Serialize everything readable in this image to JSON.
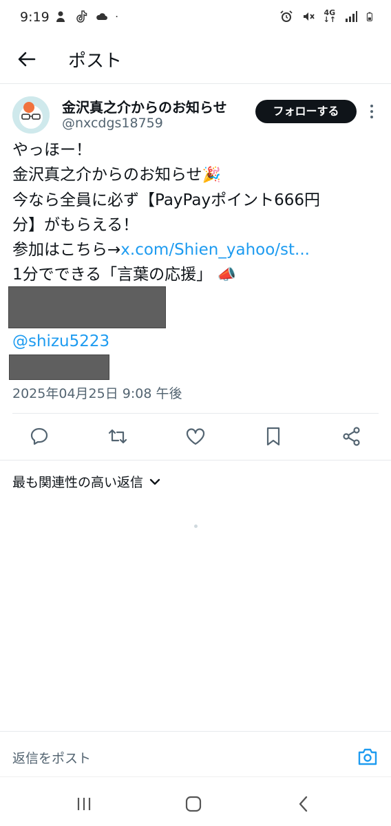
{
  "status_bar": {
    "time": "9:19",
    "network": "4G",
    "left_icons": [
      "person-icon",
      "tiktok-icon",
      "cloud-icon",
      "dot-icon"
    ],
    "right_icons": [
      "alarm-icon",
      "mute-icon",
      "signal-icon",
      "battery-icon"
    ]
  },
  "header": {
    "title": "ポスト"
  },
  "author": {
    "name": "金沢真之介からのお知らせ",
    "handle": "@nxcdgs18759",
    "follow_label": "フォローする"
  },
  "tweet": {
    "lines": [
      "やっほー！",
      "金沢真之介からのお知らせ",
      "今なら全員に必ず【PayPayポイント666円",
      "分】がもらえる！",
      "参加はこちら→",
      "1分でできる「言葉の応援」"
    ],
    "link_text": "x.com/Shien_yahoo/st...",
    "emoji_party": "🎉",
    "emoji_megaphone": "📣",
    "mention": "@shizu5223",
    "timestamp": "2025年04月25日 9:08 午後"
  },
  "actions": [
    "reply-icon",
    "retweet-icon",
    "like-icon",
    "bookmark-icon",
    "share-icon"
  ],
  "replies": {
    "sort_label": "最も関連性の高い返信"
  },
  "reply_bar": {
    "placeholder": "返信をポスト"
  },
  "nav_bar": [
    "recent-apps-icon",
    "home-icon",
    "back-nav-icon"
  ],
  "colors": {
    "link": "#1d9bf0",
    "text": "#0f1419",
    "secondary_text": "#536471",
    "follow_button_bg": "#0f1419",
    "redaction": "#5f5f5f"
  }
}
